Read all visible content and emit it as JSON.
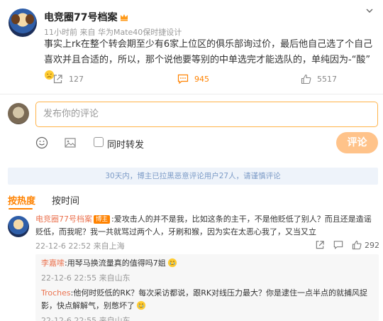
{
  "post": {
    "author": "电竞圈77号档案",
    "meta": "11小时前  来自 华为Mate40保时捷设计",
    "text": "事实上rk在整个转会期至少有6家上位区的俱乐部询过价，最后他自己选了个自己喜欢并且合适的，所以，那个说他要等别的中单选完才能选队的，单纯因为-“酸”",
    "badge_icon": "crown-badge-icon",
    "emoji": "sour-face-emoji"
  },
  "actions": {
    "repost_count": "127",
    "comment_count": "945",
    "like_count": "5517"
  },
  "compose": {
    "placeholder": "发布你的评论",
    "repost_label": "同时转发",
    "submit_label": "评论"
  },
  "notice": "30天内，博主已拉黑恶意评论用户27人，请谨慎评论",
  "sort": {
    "hot_label": "按热度",
    "time_label": "按时间"
  },
  "comment": {
    "author": "电竞圈77号档案",
    "author_tag": "博主",
    "text": ":爱攻击人的并不是我，比如这条的主干，不是他贬低了别人？而且还是造谣贬低，而我呢？我一共就骂过两个人，牙刷和猴，因为实在太恶心我了，又当又立",
    "meta": "22-12-6 22:52  来自上海",
    "like_count": "292"
  },
  "replies": [
    {
      "author": "李嘉嗦",
      "text": ":用琴马换流量真的值得吗7姐",
      "meta": "22-12-6 22:55  来自山东"
    },
    {
      "author": "Troches",
      "text": ":他何时贬低的RK？每次采访都说，跟RK对线压力最大？你是逮住一点半点的就捕风捉影，快点解解气，别憋坏了",
      "meta": "22-12-6 22:55  来自山东"
    }
  ],
  "colors": {
    "accent": "#ff8200",
    "name_link": "#eb7350",
    "notice_bg": "#eef3fa",
    "notice_text": "#7c9bc7"
  }
}
